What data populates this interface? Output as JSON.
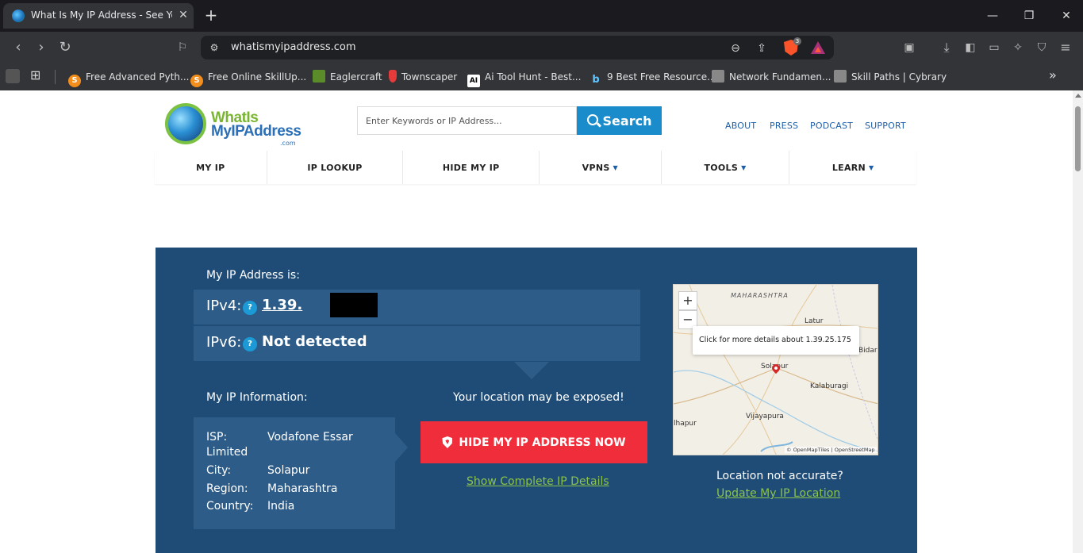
{
  "browser": {
    "tab_title": "What Is My IP Address - See Your",
    "tab_close": "✕",
    "new_tab": "+",
    "win_min": "—",
    "win_max": "❐",
    "win_close": "✕",
    "url": "whatismyipaddress.com",
    "shields_count": "3"
  },
  "bookmarks": [
    {
      "label": "Free Advanced Pyth...",
      "icon": "S"
    },
    {
      "label": "Free Online SkillUp...",
      "icon": "S"
    },
    {
      "label": "Eaglercraft",
      "icon": ""
    },
    {
      "label": "Townscaper",
      "icon": ""
    },
    {
      "label": "Ai Tool Hunt - Best...",
      "icon": "AI"
    },
    {
      "label": "9 Best Free Resource...",
      "icon": "b"
    },
    {
      "label": "Network Fundamen...",
      "icon": ""
    },
    {
      "label": "Skill Paths | Cybrary",
      "icon": ""
    }
  ],
  "site": {
    "logo": {
      "line1": "WhatIs",
      "line2": "MyIPAddress",
      "suffix": ".com"
    },
    "search": {
      "placeholder": "Enter Keywords or IP Address...",
      "button": "Search"
    },
    "top_links": [
      "ABOUT",
      "PRESS",
      "PODCAST",
      "SUPPORT"
    ],
    "nav": [
      "MY IP",
      "IP LOOKUP",
      "HIDE MY IP",
      "VPNS",
      "TOOLS",
      "LEARN"
    ],
    "nav_caret": "▼"
  },
  "hero": {
    "my_ip_label": "My IP Address is:",
    "ipv4_label": "IPv4:",
    "ipv4_value": "1.39.",
    "ipv6_label": "IPv6:",
    "ipv6_value": "Not detected",
    "help_mark": "?",
    "info_label": "My IP Information:",
    "info": {
      "isp_key": "ISP:",
      "isp_val_1": "Vodafone Essar",
      "isp_val_2": "Limited",
      "city_key": "City:",
      "city_val": "Solapur",
      "region_key": "Region:",
      "region_val": "Maharashtra",
      "country_key": "Country:",
      "country_val": "India"
    },
    "exposed_text": "Your location may be exposed!",
    "hide_button": "HIDE MY IP ADDRESS NOW",
    "show_details": "Show Complete IP Details",
    "location_not_accurate": "Location not accurate?",
    "update_location": "Update My IP Location"
  },
  "map": {
    "popup": "Click for more details about 1.39.25.175",
    "state": "MAHARASHTRA",
    "places": [
      "Latur",
      "Bidar",
      "Solapur",
      "Kalaburagi",
      "Vijayapura",
      "lhapur"
    ],
    "attribution": "© OpenMapTiles | OpenStreetMap",
    "zoom_in": "+",
    "zoom_out": "−"
  }
}
